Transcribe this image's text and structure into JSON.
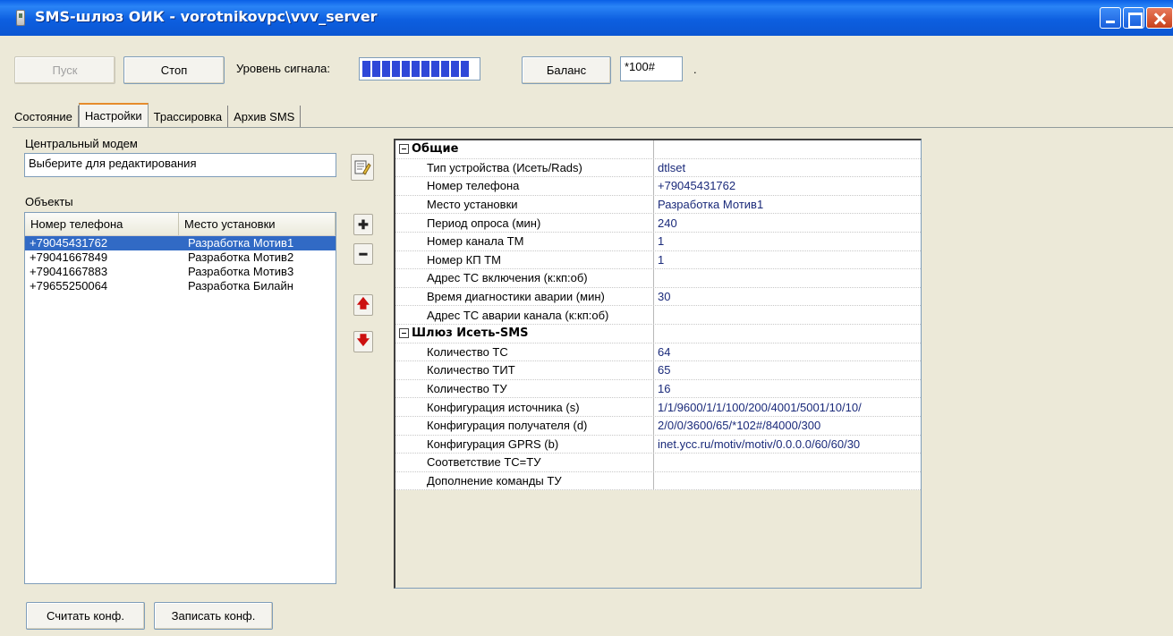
{
  "window": {
    "title": "SMS-шлюз ОИК - vorotnikovpc\\vvv_server"
  },
  "toolbar": {
    "start_label": "Пуск",
    "stop_label": "Стоп",
    "signal_label": "Уровень сигнала:",
    "signal_level": 0.9,
    "balance_label": "Баланс",
    "balance_code": "*100#",
    "trailing_dot": "."
  },
  "tabs": [
    {
      "label": "Состояние"
    },
    {
      "label": "Настройки"
    },
    {
      "label": "Трассировка"
    },
    {
      "label": "Архив SMS"
    }
  ],
  "active_tab": "Настройки",
  "central_modem": {
    "label": "Центральный модем",
    "value": "Выберите для редактирования"
  },
  "objects": {
    "label": "Объекты",
    "columns": [
      "Номер телефона",
      "Место установки"
    ],
    "rows": [
      {
        "phone": "+79045431762",
        "place": "Разработка Мотив1",
        "selected": true
      },
      {
        "phone": "+79041667849",
        "place": "Разработка Мотив2",
        "selected": false
      },
      {
        "phone": "+79041667883",
        "place": "Разработка Мотив3",
        "selected": false
      },
      {
        "phone": "+79655250064",
        "place": "Разработка Билайн",
        "selected": false
      }
    ]
  },
  "property_grid": {
    "categories": [
      {
        "name": "Общие",
        "items": [
          {
            "name": "Тип устройства (Исеть/Rads)",
            "value": "dtlset"
          },
          {
            "name": "Номер телефона",
            "value": "+79045431762"
          },
          {
            "name": "Место установки",
            "value": "Разработка Мотив1"
          },
          {
            "name": "Период опроса (мин)",
            "value": "240"
          },
          {
            "name": "Номер канала ТМ",
            "value": "1"
          },
          {
            "name": "Номер КП ТМ",
            "value": "1"
          },
          {
            "name": "Адрес ТС включения (к:кп:об)",
            "value": ""
          },
          {
            "name": "Время диагностики аварии  (мин)",
            "value": "30"
          },
          {
            "name": "Адрес ТС аварии канала (к:кп:об)",
            "value": ""
          }
        ]
      },
      {
        "name": "Шлюз Исеть-SMS",
        "items": [
          {
            "name": "Количество ТС",
            "value": "64"
          },
          {
            "name": "Количество ТИТ",
            "value": "65"
          },
          {
            "name": "Количество ТУ",
            "value": "16"
          },
          {
            "name": "Конфигурация источника (s)",
            "value": "1/1/9600/1/1/100/200/4001/5001/10/10/"
          },
          {
            "name": "Конфигурация получателя (d)",
            "value": "2/0/0/3600/65/*102#/84000/300"
          },
          {
            "name": "Конфигурация GPRS (b)",
            "value": "inet.ycc.ru/motiv/motiv/0.0.0.0/60/60/30"
          },
          {
            "name": "Соответствие ТС=ТУ",
            "value": ""
          },
          {
            "name": "Дополнение команды ТУ",
            "value": ""
          }
        ]
      }
    ]
  },
  "footer": {
    "read_label": "Считать конф.",
    "write_label": "Записать конф."
  },
  "icons": {
    "edit": "edit-modem-icon",
    "add": "plus-icon",
    "remove": "minus-icon",
    "up": "arrow-up-icon",
    "down": "arrow-down-icon"
  },
  "colors": {
    "titlebar": "#0b56d2",
    "selection": "#316ac5",
    "signal": "#2f48d8",
    "value_text": "#1a2a7a"
  }
}
